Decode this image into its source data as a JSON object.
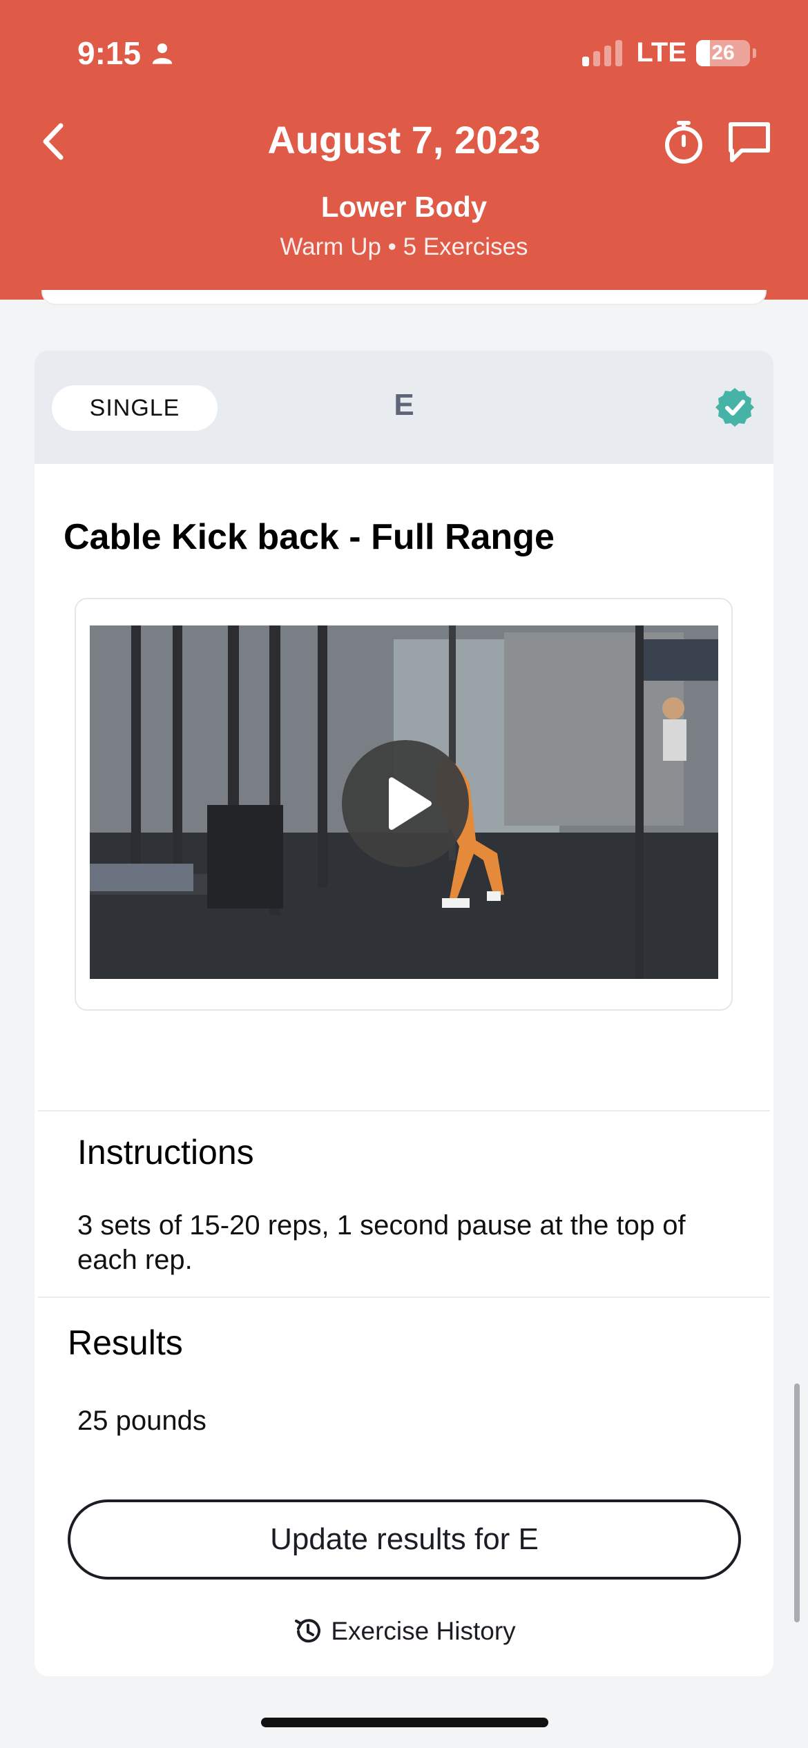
{
  "status_bar": {
    "time": "9:15",
    "network": "LTE",
    "battery": "26",
    "battery_level": 0.26
  },
  "header": {
    "title": "August 7, 2023",
    "workout_name": "Lower Body",
    "meta": "Warm Up • 5 Exercises",
    "accent_color": "#df5a47",
    "icons": [
      "chevron-left-icon",
      "stopwatch-icon",
      "chat-bubble-icon"
    ]
  },
  "exercise": {
    "type_label": "SINGLE",
    "letter": "E",
    "completed": true,
    "completed_color": "#45b3a6",
    "name": "Cable Kick back - Full Range",
    "video": {
      "has_play_button": true
    }
  },
  "instructions": {
    "heading": "Instructions",
    "text": "3 sets of 15-20 reps, 1 second pause at the top of each rep."
  },
  "results": {
    "heading": "Results",
    "value": "25 pounds",
    "update_button_label": "Update results for E",
    "history_label": "Exercise History"
  }
}
